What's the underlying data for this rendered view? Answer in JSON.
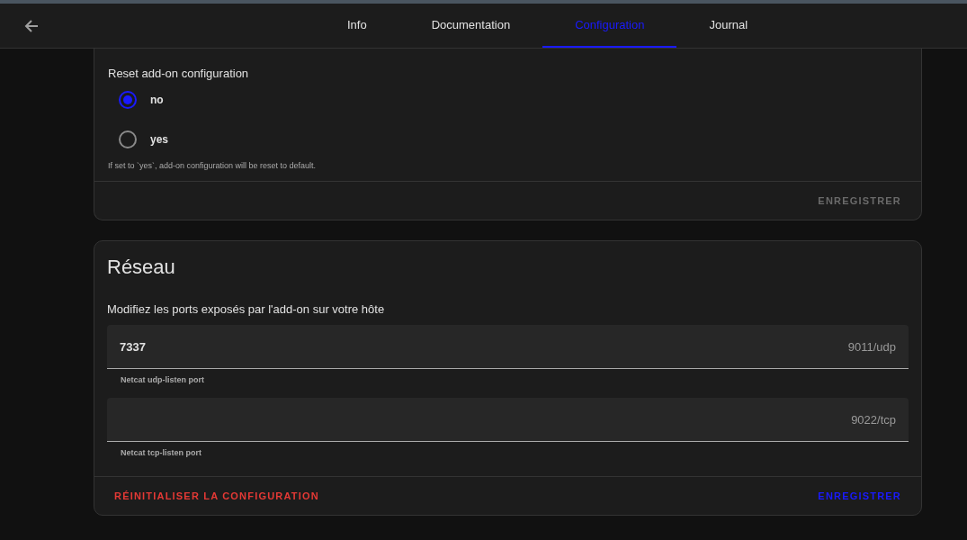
{
  "tabs": [
    {
      "label": "Info",
      "selected": false
    },
    {
      "label": "Documentation",
      "selected": false
    },
    {
      "label": "Configuration",
      "selected": true
    },
    {
      "label": "Journal",
      "selected": false
    }
  ],
  "options_card": {
    "field_label": "Reset add-on configuration",
    "options": [
      {
        "label": "no",
        "selected": true
      },
      {
        "label": "yes",
        "selected": false
      }
    ],
    "helper": "If set to `yes`, add-on configuration will be reset to default.",
    "save_button": {
      "label": "ENREGISTRER",
      "disabled": true
    }
  },
  "network_card": {
    "title": "Réseau",
    "description": "Modifiez les ports exposés par l'add-on sur votre hôte",
    "fields": [
      {
        "value": "7337",
        "suffix": "9011/udp",
        "helper": "Netcat udp-listen port"
      },
      {
        "suffix": "9022/tcp",
        "helper": "Netcat tcp-listen port"
      }
    ],
    "reset_button": {
      "label": "RÉINITIALISER LA CONFIGURATION"
    },
    "save_button": {
      "label": "ENREGISTRER",
      "disabled": false
    }
  }
}
